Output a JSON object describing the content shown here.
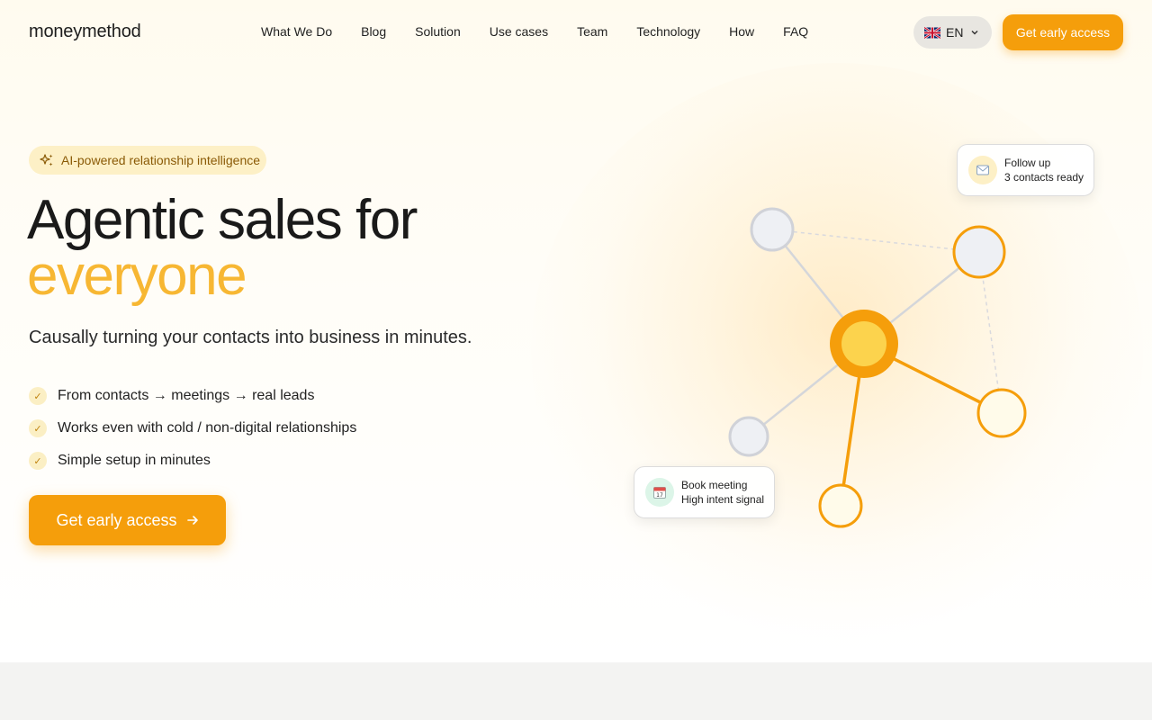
{
  "brand": {
    "name": "moneymethod"
  },
  "nav": {
    "links": [
      "What We Do",
      "Blog",
      "Solution",
      "Use cases",
      "Team",
      "Technology",
      "How",
      "FAQ"
    ],
    "language": {
      "flag_icon": "uk-flag-icon",
      "value": "EN"
    },
    "cta_label": "Get early access"
  },
  "hero": {
    "badge": "AI-powered relationship intelligence",
    "title_line1": "Agentic sales for",
    "title_line2": "everyone",
    "subtitle": "Causally turning your contacts into business in minutes.",
    "features": [
      "From contacts → meetings → real leads",
      "Works even with cold / non-digital relationships",
      "Simple setup in minutes"
    ],
    "cta_label": "Get early access",
    "cta_icon": "arrow-right-icon"
  },
  "cards": {
    "follow_up": {
      "icon": "email-icon",
      "title": "Follow up",
      "subtitle": "3 contacts ready"
    },
    "book_meeting": {
      "icon": "calendar-icon",
      "title": "Book meeting",
      "subtitle": "High intent signal"
    }
  },
  "colors": {
    "accent": "#f59e0b",
    "accent_light": "#f7b733",
    "badge_bg": "#fdf0c6",
    "node_gray": "#eef0f4"
  }
}
